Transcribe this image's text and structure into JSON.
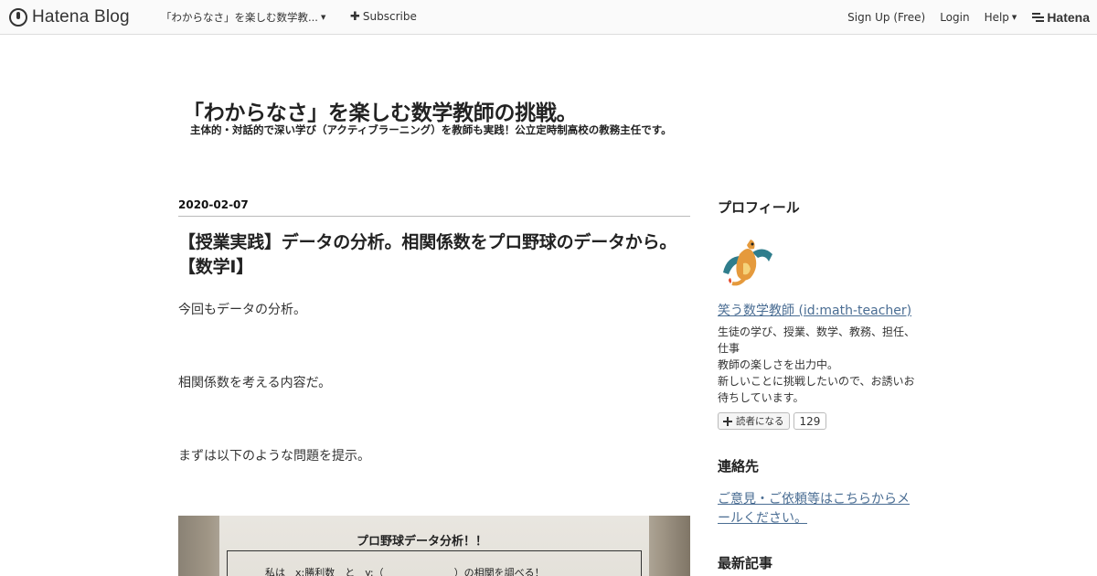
{
  "globalbar": {
    "logo_text": "Hatena Blog",
    "blog_name": "「わからなさ」を楽しむ数学教...",
    "subscribe_label": "Subscribe",
    "signup_label": "Sign Up (Free)",
    "login_label": "Login",
    "help_label": "Help",
    "hatena_label": "Hatena"
  },
  "blog": {
    "title": "「わからなさ」を楽しむ数学教師の挑戦。",
    "description": "主体的・対話的で深い学び（アクティブラーニング）を教師も実践！公立定時制高校の教務主任です。"
  },
  "entry": {
    "date": "2020-02-07",
    "title": "【授業実践】データの分析。相関係数をプロ野球のデータから。【数学Ⅰ】",
    "paragraphs": [
      "今回もデータの分析。",
      "相関係数を考える内容だ。",
      "まずは以下のような問題を提示。"
    ],
    "photo": {
      "heading": "プロ野球データ分析！！",
      "line": "私は　x:勝利数　と　y:（　　　　　　　）の相関を調べる！"
    }
  },
  "sidebar": {
    "profile_heading": "プロフィール",
    "profile_name": "笑う数学教師 (id:math-teacher)",
    "profile_desc": [
      "生徒の学び、授業、数学、教務、担任、",
      "仕事",
      "教師の楽しさを出力中。",
      "新しいことに挑戦したいので、お誘いお",
      "待ちしています。"
    ],
    "subscribe_label": "読者になる",
    "subscriber_count": "129",
    "contact_heading": "連絡先",
    "contact_link": [
      "ご意見・ご依頼等はこちらからメ",
      "ールください。"
    ],
    "recent_heading": "最新記事"
  },
  "colors": {
    "link": "#4a6d93",
    "text": "#333333",
    "bar_background": "#fafafa"
  }
}
